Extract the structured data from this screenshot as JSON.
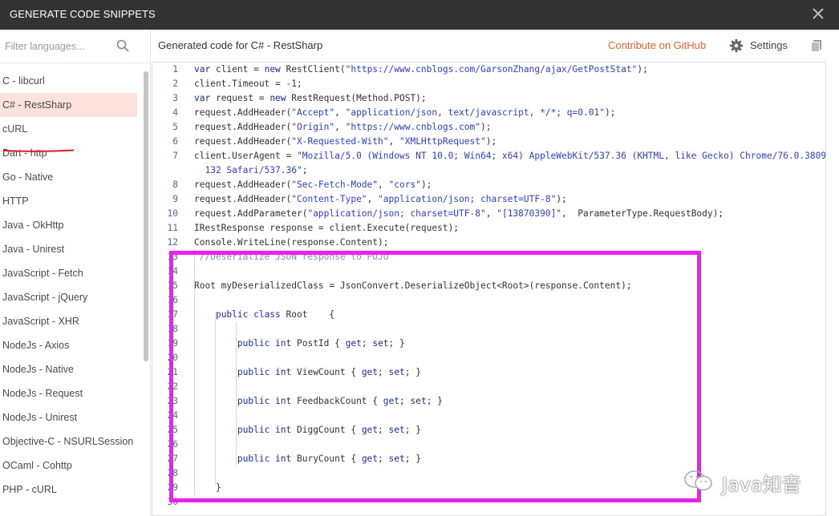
{
  "window": {
    "title": "GENERATE CODE SNIPPETS"
  },
  "sidebar": {
    "filter_placeholder": "Filter languages...",
    "languages": [
      "C - libcurl",
      "C# - RestSharp",
      "cURL",
      "Dart - http",
      "Go - Native",
      "HTTP",
      "Java - OkHttp",
      "Java - Unirest",
      "JavaScript - Fetch",
      "JavaScript - jQuery",
      "JavaScript - XHR",
      "NodeJs - Axios",
      "NodeJs - Native",
      "NodeJs - Request",
      "NodeJs - Unirest",
      "Objective-C - NSURLSession",
      "OCaml - Cohttp",
      "PHP - cURL"
    ],
    "selected_index": 1
  },
  "main": {
    "title": "Generated code for C# - RestSharp",
    "contribute_label": "Contribute on GitHub",
    "settings_label": "Settings"
  },
  "code": {
    "lines": [
      {
        "n": "1",
        "segs": [
          [
            "kw",
            "var"
          ],
          [
            "p",
            " client = "
          ],
          [
            "kw",
            "new"
          ],
          [
            "p",
            " RestClient("
          ],
          [
            "str",
            "\"https://www.cnblogs.com/GarsonZhang/ajax/GetPostStat\""
          ],
          [
            "p",
            ");"
          ]
        ]
      },
      {
        "n": "2",
        "segs": [
          [
            "p",
            "client.Timeout = -1;"
          ]
        ]
      },
      {
        "n": "3",
        "segs": [
          [
            "kw",
            "var"
          ],
          [
            "p",
            " request = "
          ],
          [
            "kw",
            "new"
          ],
          [
            "p",
            " RestRequest(Method.POST);"
          ]
        ]
      },
      {
        "n": "4",
        "segs": [
          [
            "p",
            "request.AddHeader("
          ],
          [
            "str",
            "\"Accept\""
          ],
          [
            "p",
            ", "
          ],
          [
            "str",
            "\"application/json, text/javascript, */*; q=0.01\""
          ],
          [
            "p",
            ");"
          ]
        ]
      },
      {
        "n": "5",
        "segs": [
          [
            "p",
            "request.AddHeader("
          ],
          [
            "str",
            "\"Origin\""
          ],
          [
            "p",
            ", "
          ],
          [
            "str",
            "\"https://www.cnblogs.com\""
          ],
          [
            "p",
            ");"
          ]
        ]
      },
      {
        "n": "6",
        "segs": [
          [
            "p",
            "request.AddHeader("
          ],
          [
            "str",
            "\"X-Requested-With\""
          ],
          [
            "p",
            ", "
          ],
          [
            "str",
            "\"XMLHttpRequest\""
          ],
          [
            "p",
            ");"
          ]
        ]
      },
      {
        "n": "7",
        "segs": [
          [
            "p",
            "client.UserAgent = "
          ],
          [
            "str",
            "\"Mozilla/5.0 (Windows NT 10.0; Win64; x64) AppleWebKit/537.36 (KHTML, like Gecko) Chrome/76.0.3809."
          ]
        ]
      },
      {
        "n": "",
        "segs": [
          [
            "str",
            "  132 Safari/537.36\""
          ],
          [
            "p",
            ";"
          ]
        ]
      },
      {
        "n": "8",
        "segs": [
          [
            "p",
            "request.AddHeader("
          ],
          [
            "str",
            "\"Sec-Fetch-Mode\""
          ],
          [
            "p",
            ", "
          ],
          [
            "str",
            "\"cors\""
          ],
          [
            "p",
            ");"
          ]
        ]
      },
      {
        "n": "9",
        "segs": [
          [
            "p",
            "request.AddHeader("
          ],
          [
            "str",
            "\"Content-Type\""
          ],
          [
            "p",
            ", "
          ],
          [
            "str",
            "\"application/json; charset=UTF-8\""
          ],
          [
            "p",
            ");"
          ]
        ]
      },
      {
        "n": "10",
        "segs": [
          [
            "p",
            "request.AddParameter("
          ],
          [
            "str",
            "\"application/json; charset=UTF-8\""
          ],
          [
            "p",
            ", "
          ],
          [
            "str",
            "\"[13870390]\""
          ],
          [
            "p",
            ",  ParameterType.RequestBody);"
          ]
        ]
      },
      {
        "n": "11",
        "segs": [
          [
            "p",
            "IRestResponse response = client.Execute(request);"
          ]
        ]
      },
      {
        "n": "12",
        "segs": [
          [
            "p",
            "Console.WriteLine(response.Content);"
          ]
        ]
      },
      {
        "n": "13",
        "segs": [
          [
            "cmt",
            " //Deserialize JSON response to POJO"
          ]
        ]
      },
      {
        "n": "14",
        "segs": []
      },
      {
        "n": "15",
        "segs": [
          [
            "p",
            "Root myDeserializedClass = JsonConvert.DeserializeObject<Root>(response.Content);"
          ]
        ]
      },
      {
        "n": "16",
        "segs": []
      },
      {
        "n": "17",
        "segs": [
          [
            "p",
            "    "
          ],
          [
            "kw",
            "public class"
          ],
          [
            "p",
            " Root    {"
          ]
        ]
      },
      {
        "n": "18",
        "segs": []
      },
      {
        "n": "19",
        "segs": [
          [
            "p",
            "        "
          ],
          [
            "kw",
            "public int"
          ],
          [
            "p",
            " PostId { "
          ],
          [
            "kw",
            "get"
          ],
          [
            "p",
            "; "
          ],
          [
            "kw",
            "set"
          ],
          [
            "p",
            "; }"
          ]
        ]
      },
      {
        "n": "20",
        "segs": []
      },
      {
        "n": "21",
        "segs": [
          [
            "p",
            "        "
          ],
          [
            "kw",
            "public int"
          ],
          [
            "p",
            " ViewCount { "
          ],
          [
            "kw",
            "get"
          ],
          [
            "p",
            "; "
          ],
          [
            "kw",
            "set"
          ],
          [
            "p",
            "; }"
          ]
        ]
      },
      {
        "n": "22",
        "segs": []
      },
      {
        "n": "23",
        "segs": [
          [
            "p",
            "        "
          ],
          [
            "kw",
            "public int"
          ],
          [
            "p",
            " FeedbackCount { "
          ],
          [
            "kw",
            "get"
          ],
          [
            "p",
            "; "
          ],
          [
            "kw",
            "set"
          ],
          [
            "p",
            "; }"
          ]
        ]
      },
      {
        "n": "24",
        "segs": []
      },
      {
        "n": "25",
        "segs": [
          [
            "p",
            "        "
          ],
          [
            "kw",
            "public int"
          ],
          [
            "p",
            " DiggCount { "
          ],
          [
            "kw",
            "get"
          ],
          [
            "p",
            "; "
          ],
          [
            "kw",
            "set"
          ],
          [
            "p",
            "; }"
          ]
        ]
      },
      {
        "n": "26",
        "segs": []
      },
      {
        "n": "27",
        "segs": [
          [
            "p",
            "        "
          ],
          [
            "kw",
            "public int"
          ],
          [
            "p",
            " BuryCount { "
          ],
          [
            "kw",
            "get"
          ],
          [
            "p",
            "; "
          ],
          [
            "kw",
            "set"
          ],
          [
            "p",
            "; }"
          ]
        ]
      },
      {
        "n": "28",
        "segs": []
      },
      {
        "n": "29",
        "segs": [
          [
            "p",
            "    }"
          ]
        ]
      },
      {
        "n": "30",
        "segs": []
      }
    ]
  },
  "annotation": {
    "box_color": "#f01ff0",
    "underline_color": "#e0201c"
  },
  "watermark": {
    "text": "Java知音"
  },
  "colors": {
    "accent": "#e4632b",
    "selected_bg": "#fbe2dc",
    "titlebar_bg": "#333333"
  }
}
